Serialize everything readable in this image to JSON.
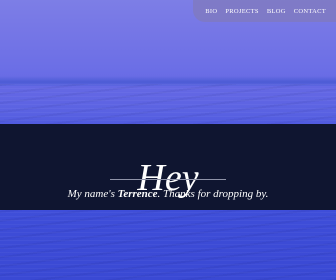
{
  "nav": {
    "items": [
      {
        "label": "BIO"
      },
      {
        "label": "PROJECTS"
      },
      {
        "label": "BLOG"
      },
      {
        "label": "CONTACT"
      }
    ]
  },
  "hero": {
    "title": "Hey",
    "subtitle_prefix": "My name's ",
    "subtitle_name": "Terrence",
    "subtitle_suffix": ". Thanks for dropping by."
  },
  "colors": {
    "band": "#0f1530",
    "sky": "#7d7ee6",
    "sea": "#3a49d4",
    "nav_bg": "#807abe"
  }
}
